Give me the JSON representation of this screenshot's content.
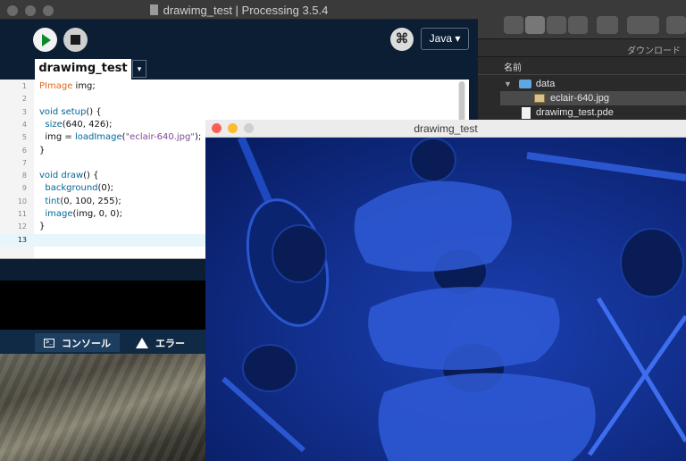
{
  "ide": {
    "title": "drawimg_test | Processing 3.5.4",
    "mode_label": "Java ▾",
    "debug_glyph": "⌘",
    "tab_label": "drawimg_test",
    "tab_menu_glyph": "▾",
    "lines": [
      {
        "n": "1",
        "parts": [
          {
            "t": "PImage",
            "c": "kw"
          },
          {
            "t": " img;",
            "c": ""
          }
        ]
      },
      {
        "n": "2",
        "parts": []
      },
      {
        "n": "3",
        "parts": [
          {
            "t": "void",
            "c": "fn"
          },
          {
            "t": " ",
            "c": ""
          },
          {
            "t": "setup",
            "c": "fn"
          },
          {
            "t": "() {",
            "c": ""
          }
        ]
      },
      {
        "n": "4",
        "parts": [
          {
            "t": "  ",
            "c": ""
          },
          {
            "t": "size",
            "c": "fn"
          },
          {
            "t": "(640, 426);",
            "c": ""
          }
        ]
      },
      {
        "n": "5",
        "parts": [
          {
            "t": "  img = ",
            "c": ""
          },
          {
            "t": "loadImage",
            "c": "fn"
          },
          {
            "t": "(",
            "c": ""
          },
          {
            "t": "\"eclair-640.jpg\"",
            "c": "str"
          },
          {
            "t": ");",
            "c": ""
          }
        ]
      },
      {
        "n": "6",
        "parts": [
          {
            "t": "}",
            "c": ""
          }
        ]
      },
      {
        "n": "7",
        "parts": []
      },
      {
        "n": "8",
        "parts": [
          {
            "t": "void",
            "c": "fn"
          },
          {
            "t": " ",
            "c": ""
          },
          {
            "t": "draw",
            "c": "fn"
          },
          {
            "t": "() {",
            "c": ""
          }
        ]
      },
      {
        "n": "9",
        "parts": [
          {
            "t": "  ",
            "c": ""
          },
          {
            "t": "background",
            "c": "fn"
          },
          {
            "t": "(0);",
            "c": ""
          }
        ]
      },
      {
        "n": "10",
        "parts": [
          {
            "t": "  ",
            "c": ""
          },
          {
            "t": "tint",
            "c": "fn"
          },
          {
            "t": "(0, 100, 255);",
            "c": ""
          }
        ]
      },
      {
        "n": "11",
        "parts": [
          {
            "t": "  ",
            "c": ""
          },
          {
            "t": "image",
            "c": "fn"
          },
          {
            "t": "(img, 0, 0);",
            "c": ""
          }
        ]
      },
      {
        "n": "12",
        "parts": [
          {
            "t": "}",
            "c": ""
          }
        ]
      },
      {
        "n": "13",
        "parts": []
      }
    ],
    "active_line": "13",
    "console_tab": "コンソール",
    "error_tab": "エラー"
  },
  "finder": {
    "path_label": "ダウンロード",
    "column_header": "名前",
    "items": [
      {
        "label": "data",
        "kind": "folder"
      },
      {
        "label": "eclair-640.jpg",
        "kind": "jpg"
      },
      {
        "label": "drawimg_test.pde",
        "kind": "doc"
      }
    ]
  },
  "sketch_window": {
    "title": "drawimg_test"
  },
  "colors": {
    "ide_background": "#0b1e33",
    "keyword": "#e2661a",
    "function": "#006699",
    "string": "#7d4793",
    "tinted_image": "#0d2d8a"
  }
}
